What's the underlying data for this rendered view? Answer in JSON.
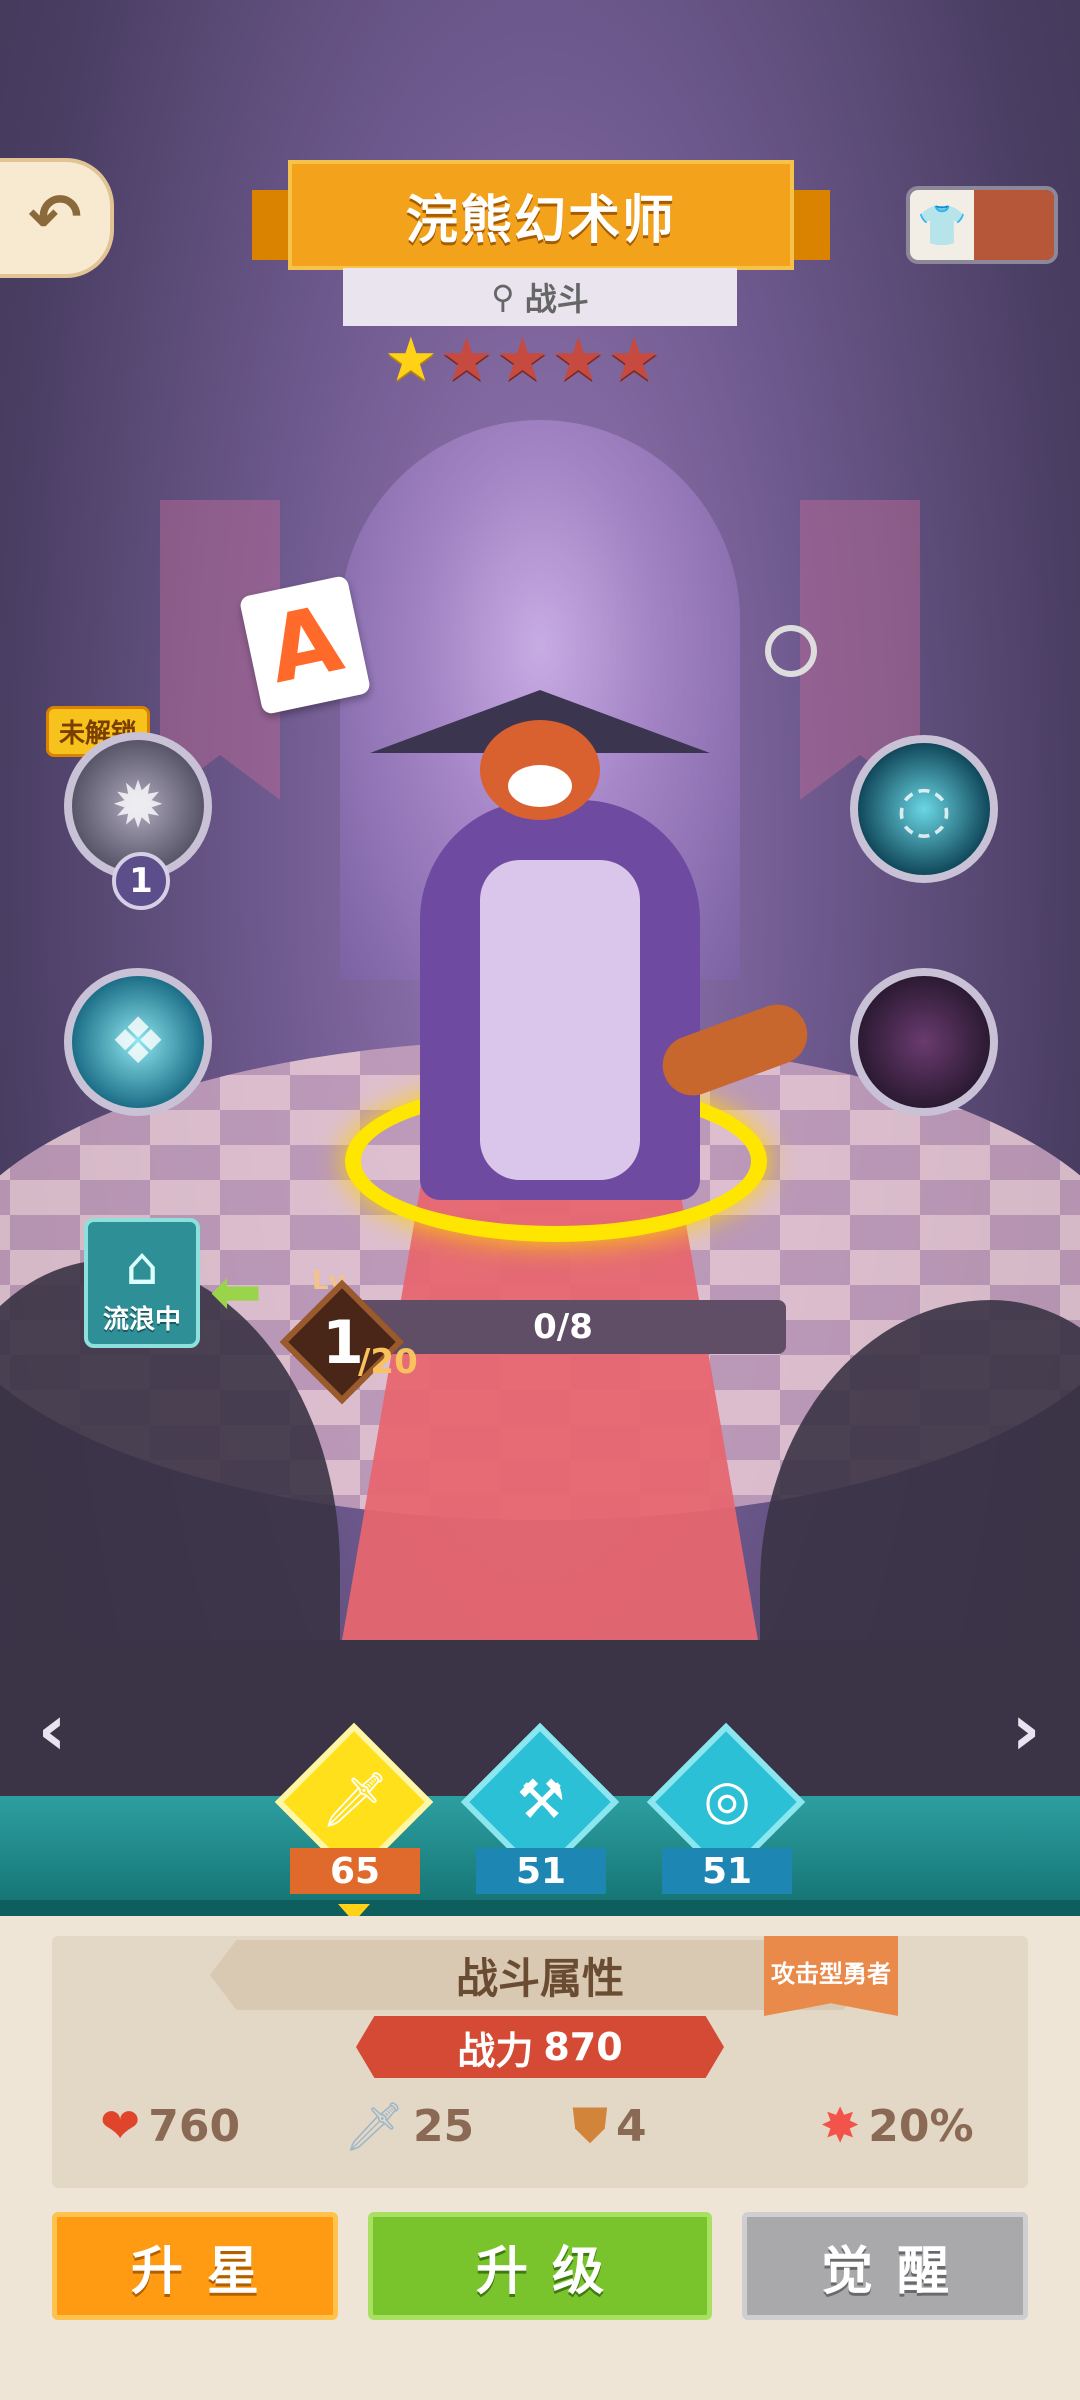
{
  "header": {
    "hero_name": "浣熊幻术师",
    "role": "战斗",
    "stars_total": 5,
    "stars_filled": 1
  },
  "skills": {
    "locked_tag": "未解锁",
    "locked_skill_level": "1"
  },
  "wander": {
    "label": "流浪中"
  },
  "level": {
    "prefix": "Lv",
    "current": "1",
    "max": "/20",
    "exp": "0/8"
  },
  "tabs": [
    {
      "name": "sword",
      "value": "65",
      "selected": true
    },
    {
      "name": "hammer",
      "value": "51",
      "selected": false
    },
    {
      "name": "compass",
      "value": "51",
      "selected": false
    }
  ],
  "stats": {
    "title": "战斗属性",
    "type_tag": "攻击型勇者",
    "power_label": "战力",
    "power_value": "870",
    "hp": "760",
    "attack": "25",
    "defense": "4",
    "crit": "20%"
  },
  "actions": {
    "star_up": "升星",
    "level_up": "升级",
    "awaken": "觉醒"
  },
  "colors": {
    "title_orange": "#f3a31b",
    "star_on": "#ffd218",
    "star_off": "#c64a40",
    "level_up_green": "#79c42d",
    "star_up_orange": "#ff9b12",
    "awaken_gray": "#a9a9ab",
    "teal_strip": "#2d9fa1"
  }
}
